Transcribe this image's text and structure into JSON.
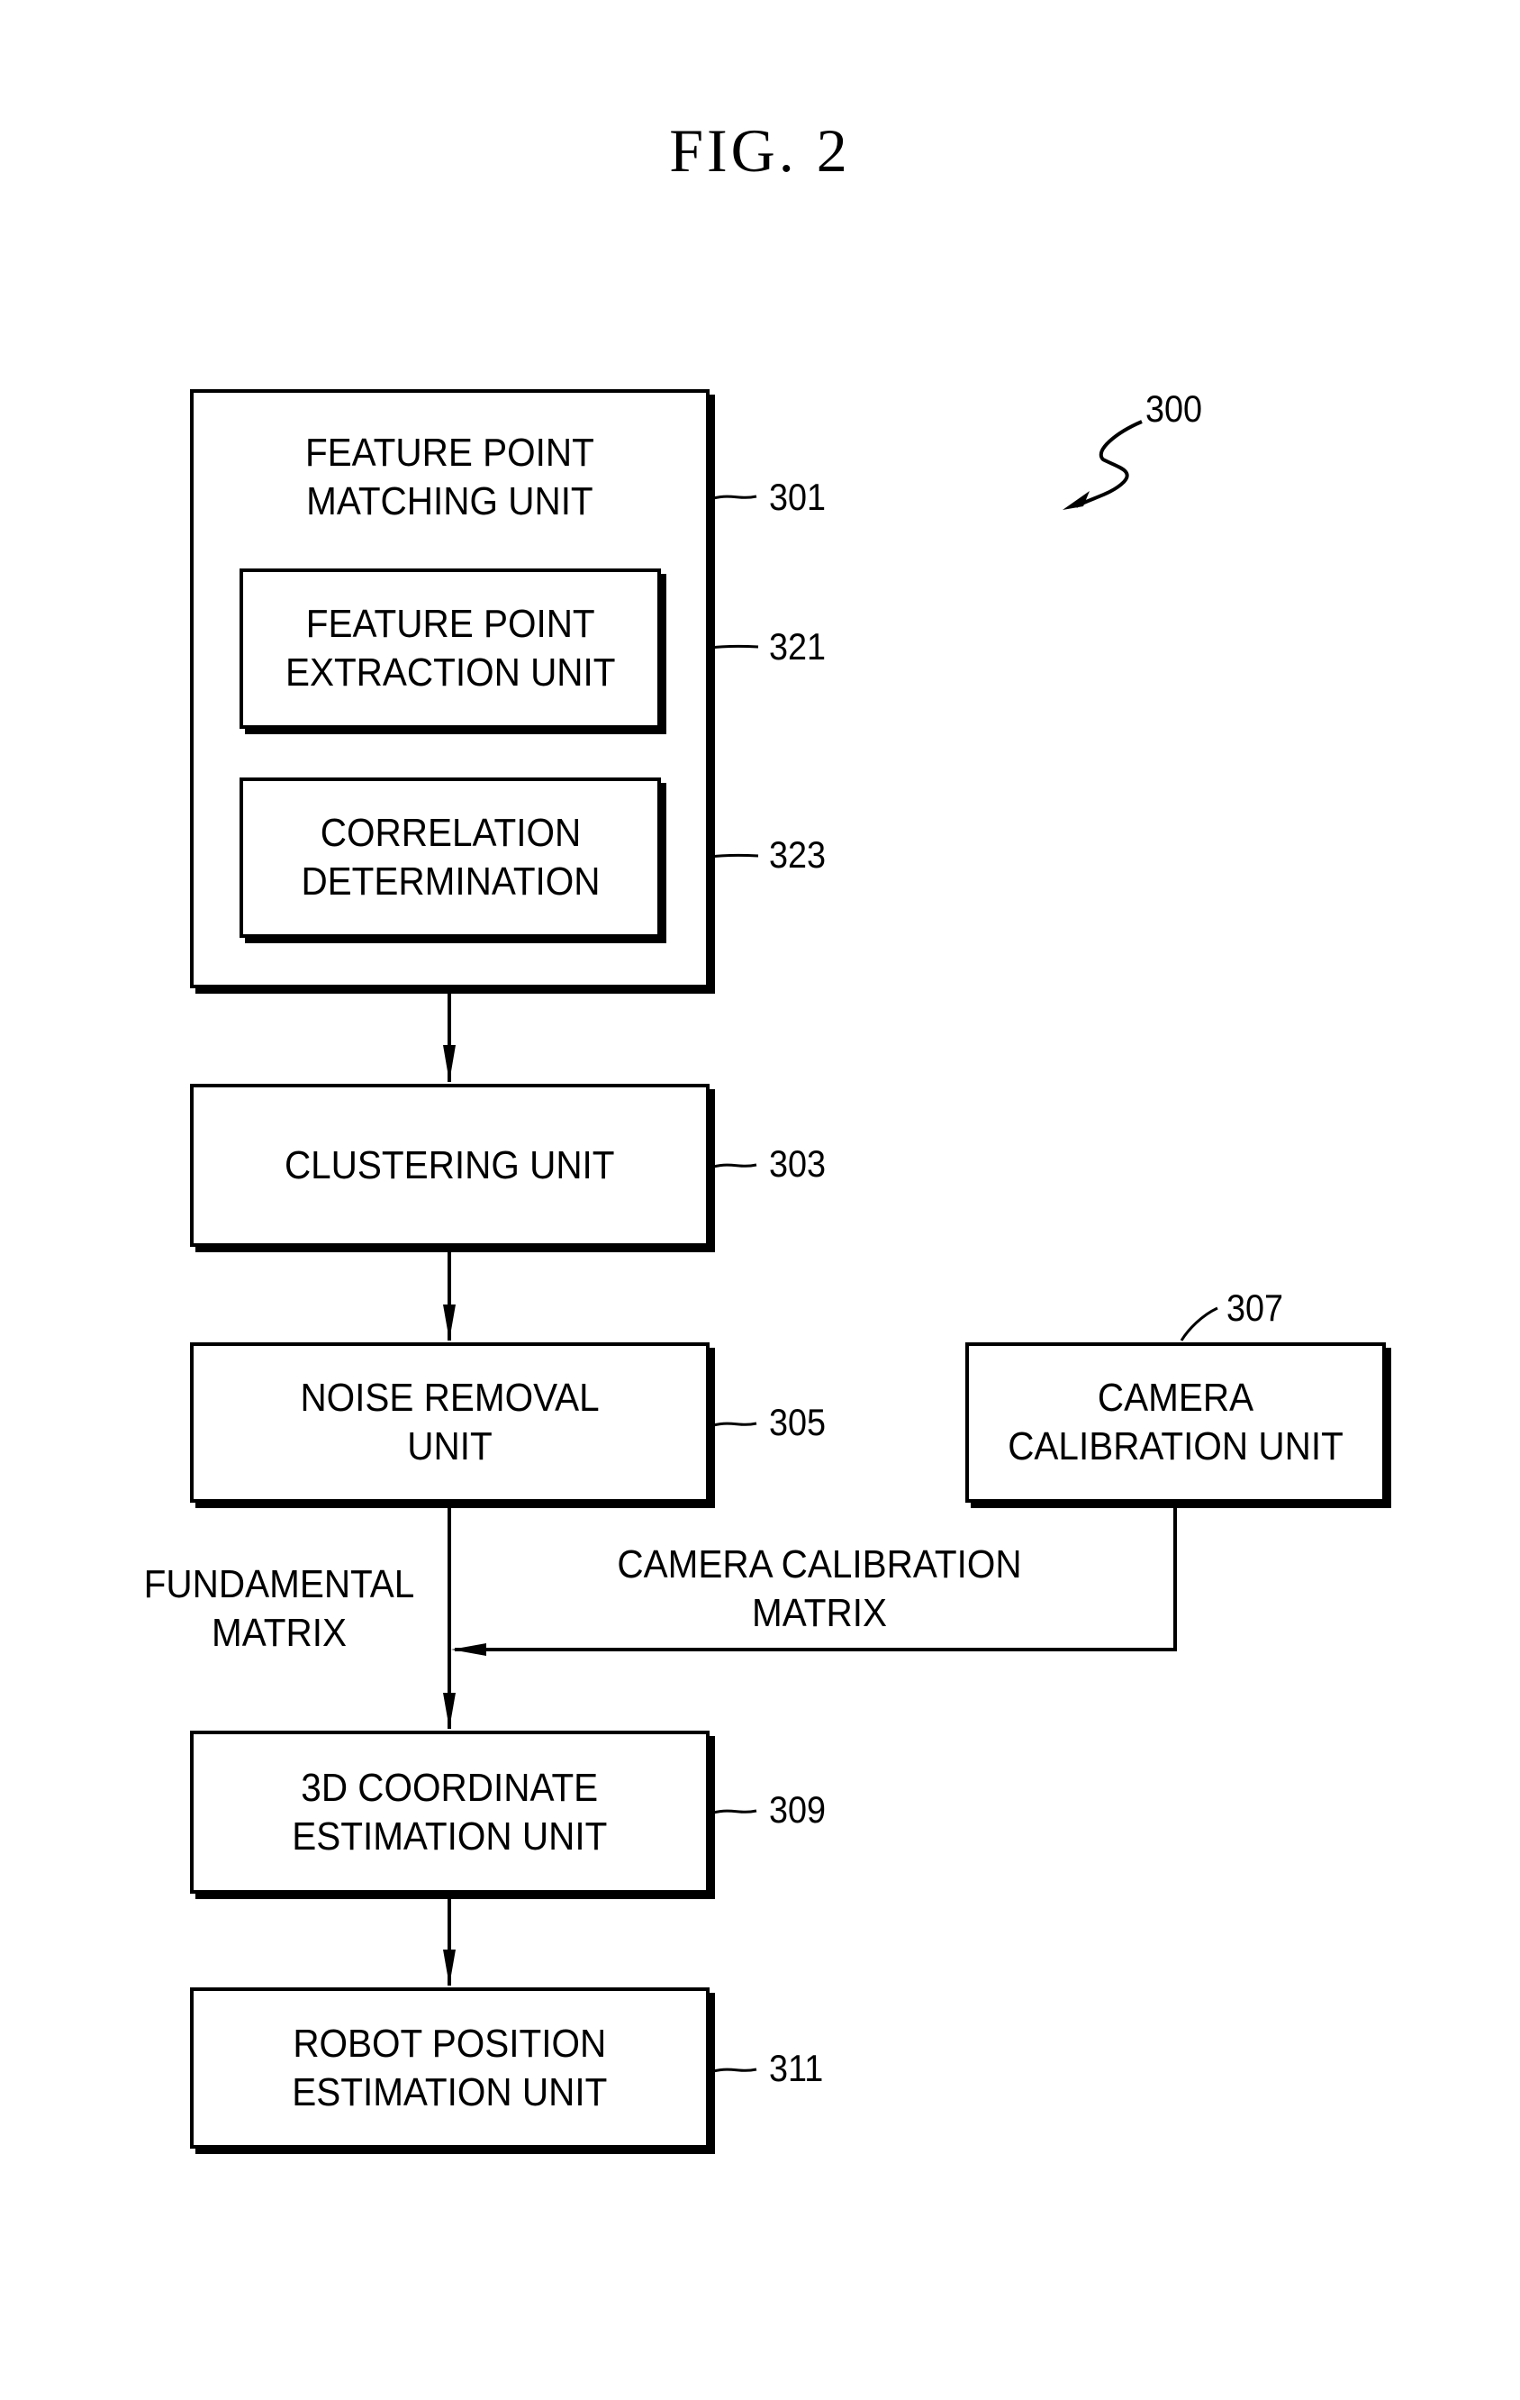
{
  "figure": {
    "title": "FIG.  2",
    "system_ref": "300"
  },
  "blocks": {
    "matching": {
      "label": "FEATURE POINT\nMATCHING UNIT",
      "ref": "301"
    },
    "extraction": {
      "label": "FEATURE POINT\nEXTRACTION UNIT",
      "ref": "321"
    },
    "correlation": {
      "label": "CORRELATION\nDETERMINATION",
      "ref": "323"
    },
    "clustering": {
      "label": "CLUSTERING UNIT",
      "ref": "303"
    },
    "noise": {
      "label": "NOISE REMOVAL\nUNIT",
      "ref": "305"
    },
    "camera": {
      "label": "CAMERA\nCALIBRATION UNIT",
      "ref": "307"
    },
    "coord3d": {
      "label": "3D COORDINATE\nESTIMATION UNIT",
      "ref": "309"
    },
    "robot": {
      "label": "ROBOT POSITION\nESTIMATION UNIT",
      "ref": "311"
    }
  },
  "edge_labels": {
    "fundamental": "FUNDAMENTAL\nMATRIX",
    "camera_matrix": "CAMERA CALIBRATION\nMATRIX"
  }
}
